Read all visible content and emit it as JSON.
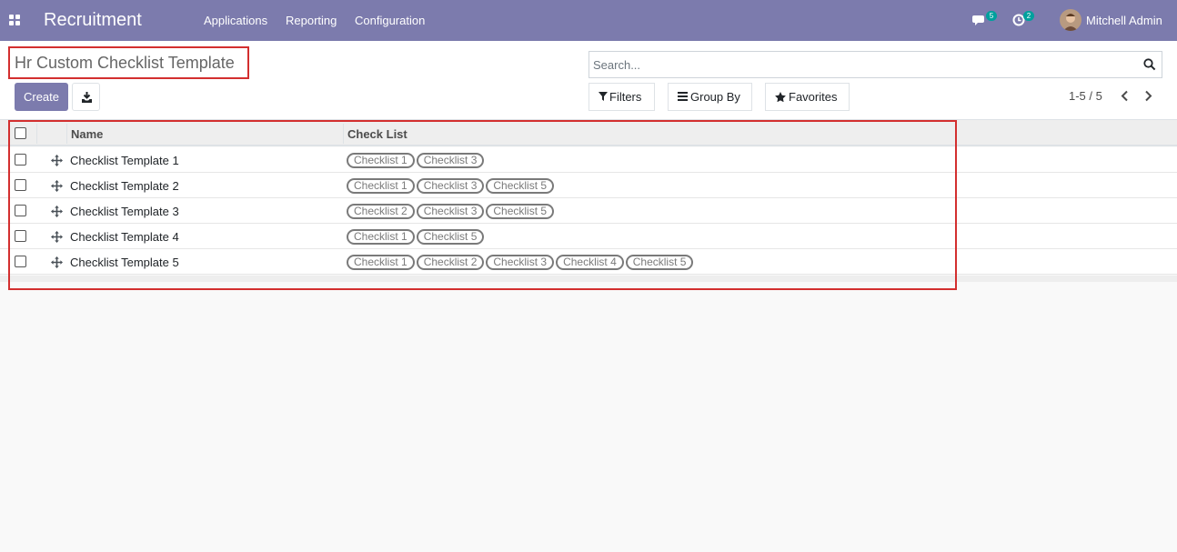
{
  "navbar": {
    "app_title": "Recruitment",
    "menu": [
      {
        "label": "Applications"
      },
      {
        "label": "Reporting"
      },
      {
        "label": "Configuration"
      }
    ],
    "messages_count": "5",
    "activities_count": "2",
    "user_name": "Mitchell Admin",
    "bg_color": "#7c7bad",
    "badge_color": "#00a09d"
  },
  "control_panel": {
    "breadcrumb": "Hr Custom Checklist Template",
    "create_label": "Create",
    "search_placeholder": "Search...",
    "filters_label": "Filters",
    "groupby_label": "Group By",
    "favorites_label": "Favorites",
    "pager": "1-5 / 5"
  },
  "table": {
    "headers": {
      "name": "Name",
      "checklist": "Check List"
    },
    "rows": [
      {
        "name": "Checklist Template 1",
        "tags": [
          "Checklist 1",
          "Checklist 3"
        ]
      },
      {
        "name": "Checklist Template 2",
        "tags": [
          "Checklist 1",
          "Checklist 3",
          "Checklist 5"
        ]
      },
      {
        "name": "Checklist Template 3",
        "tags": [
          "Checklist 2",
          "Checklist 3",
          "Checklist 5"
        ]
      },
      {
        "name": "Checklist Template 4",
        "tags": [
          "Checklist 1",
          "Checklist 5"
        ]
      },
      {
        "name": "Checklist Template 5",
        "tags": [
          "Checklist 1",
          "Checklist 2",
          "Checklist 3",
          "Checklist 4",
          "Checklist 5"
        ]
      }
    ]
  },
  "accent_color": "#d32f2f"
}
